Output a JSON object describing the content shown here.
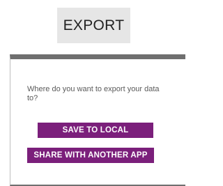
{
  "export_button": {
    "label": "EXPORT"
  },
  "dialog": {
    "message": "Where do you want to export your data to?",
    "save_label": "SAVE TO LOCAL",
    "share_label": "SHARE WITH ANOTHER APP"
  },
  "colors": {
    "accent": "#7b1f7b",
    "export_bg": "#e6e6e6",
    "dialog_border": "#6f6f6f"
  }
}
